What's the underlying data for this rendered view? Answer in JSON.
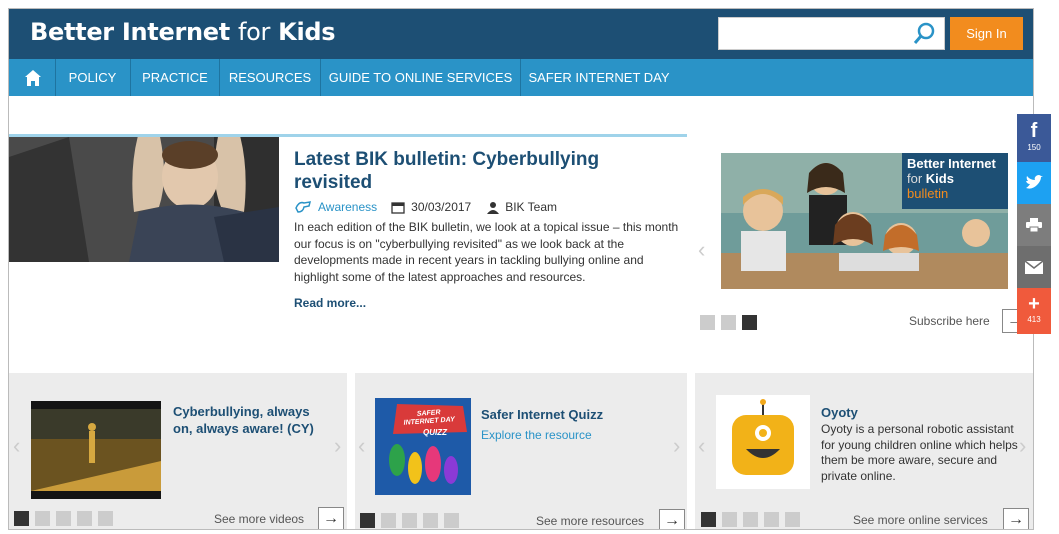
{
  "header": {
    "logo_bold_1": "Better Internet",
    "logo_thin": "for",
    "logo_bold_2": "Kids",
    "search_placeholder": "",
    "signin_label": "Sign In"
  },
  "nav": {
    "home_icon": "home-icon",
    "items": [
      "POLICY",
      "PRACTICE",
      "RESOURCES",
      "GUIDE TO ONLINE SERVICES",
      "SAFER INTERNET DAY"
    ]
  },
  "featured": {
    "title": "Latest BIK bulletin: Cyberbullying revisited",
    "category": "Awareness",
    "date": "30/03/2017",
    "author": "BIK Team",
    "body": "In each edition of the BIK bulletin, we look at a topical issue – this month our focus is on \"cyberbullying revisited\" as we look back at the developments made in recent years in tackling bullying online and highlight some of the latest approaches and resources.",
    "read_more": "Read more..."
  },
  "bulletin": {
    "image_line1": "Better Internet",
    "image_line2a": "for",
    "image_line2b": "Kids",
    "image_line3": "bulletin",
    "subscribe_label": "Subscribe here",
    "active_dot": 3
  },
  "social": {
    "facebook_count": "150",
    "plus_count": "413",
    "colors": {
      "facebook": "#3b5998",
      "twitter": "#1da1f2",
      "print": "#7d7d7d",
      "email": "#6e6e6e",
      "plus": "#f05a3c"
    }
  },
  "panels": [
    {
      "title": "Cyberbullying, always on, always aware! (CY)",
      "more": "See more videos",
      "active_dot": 1
    },
    {
      "title": "Safer Internet Quizz",
      "sub": "Explore the resource",
      "quiz_text": "SAFER INTERNET DAY",
      "quiz_word": "QUIZZ",
      "more": "See more resources",
      "active_dot": 1
    },
    {
      "title": "Oyoty",
      "body": "Oyoty is a personal robotic assistant for young children online which helps them be more aware, secure and private online.",
      "more": "See more online services",
      "active_dot": 1
    }
  ],
  "colors": {
    "header": "#1d4f74",
    "nav": "#2a93c7",
    "signin": "#f28c1e"
  }
}
